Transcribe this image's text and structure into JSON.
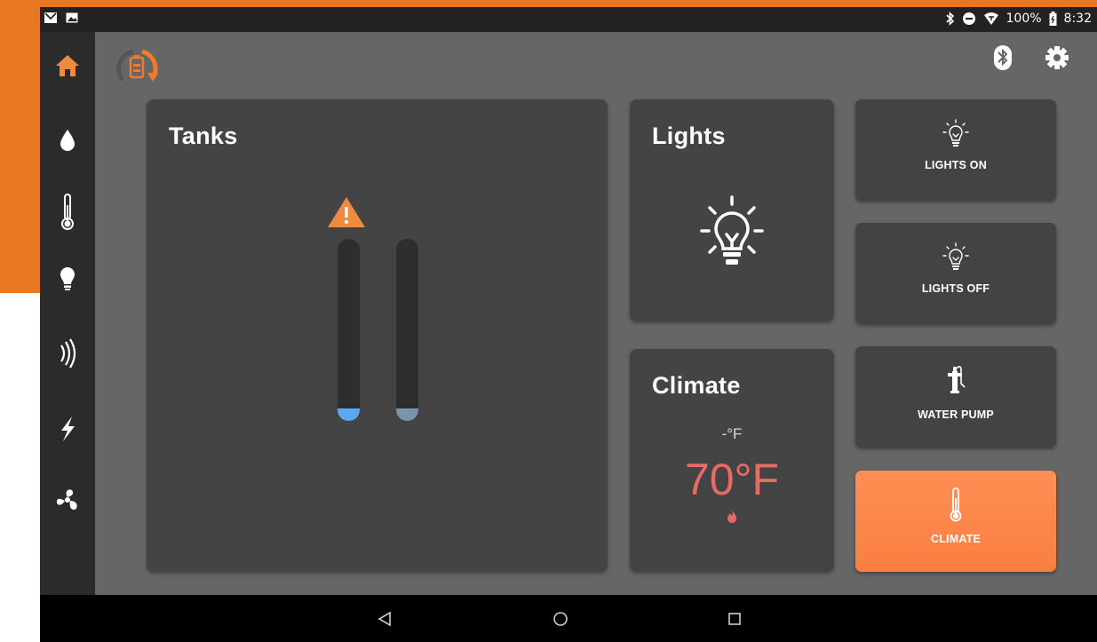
{
  "status_bar": {
    "battery": "100%",
    "time": "8:32"
  },
  "sidebar": {
    "items": [
      {
        "icon": "home-icon",
        "active": true
      },
      {
        "icon": "water-drop-icon",
        "active": false
      },
      {
        "icon": "thermometer-icon",
        "active": false
      },
      {
        "icon": "lightbulb-icon",
        "active": false
      },
      {
        "icon": "signal-waves-icon",
        "active": false
      },
      {
        "icon": "lightning-icon",
        "active": false
      },
      {
        "icon": "fan-icon",
        "active": false
      }
    ]
  },
  "header": {
    "logo_icon": "battery-sync-icon",
    "actions": [
      "bluetooth-icon",
      "gear-icon"
    ]
  },
  "tanks": {
    "title": "Tanks",
    "warning_icon": "warning-icon",
    "levels": [
      {
        "fill_fraction": 0.06,
        "color": "#5aa9f0"
      },
      {
        "fill_fraction": 0.06,
        "color": "#7a94ad"
      }
    ]
  },
  "lights_card": {
    "title": "Lights",
    "icon": "lightbulb-icon"
  },
  "climate_card": {
    "title": "Climate",
    "setpoint": "-°F",
    "temperature": "70°F",
    "heat_icon": "flame-icon",
    "temp_color": "#e96a64"
  },
  "buttons": {
    "lights_on": "LIGHTS ON",
    "lights_off": "LIGHTS OFF",
    "water_pump": "WATER PUMP",
    "climate": "CLIMATE"
  },
  "colors": {
    "accent": "#e87722",
    "active_button": "#f98b4e",
    "card": "#444444",
    "main_bg": "#666666",
    "sidebar": "#2b2b2b"
  }
}
